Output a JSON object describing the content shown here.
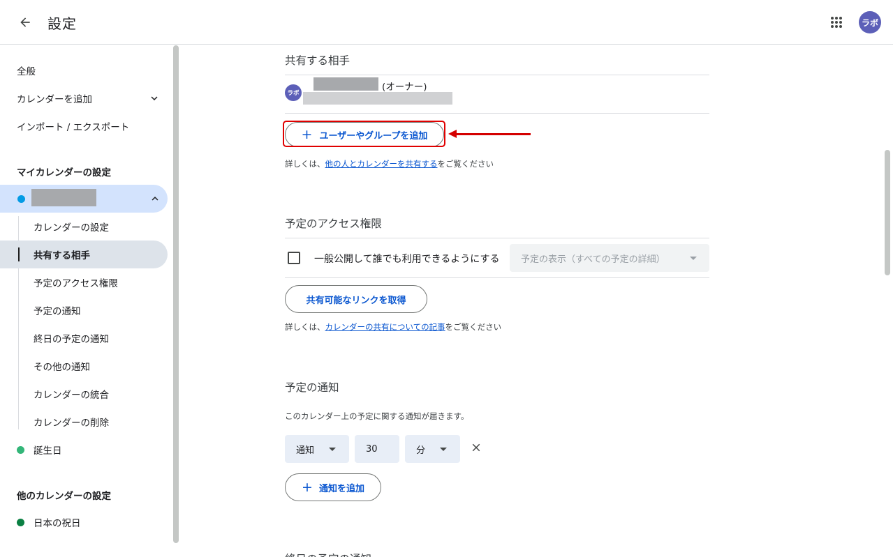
{
  "header": {
    "title": "設定",
    "avatar_text": "ラボ",
    "back_icon": "arrow-left-icon",
    "apps_icon": "apps-grid-icon"
  },
  "sidebar": {
    "general": "全般",
    "add_calendar": "カレンダーを追加",
    "import_export": "インポート / エクスポート",
    "my_calendars_heading": "マイカレンダーの設定",
    "sub_items": [
      "カレンダーの設定",
      "共有する相手",
      "予定のアクセス権限",
      "予定の通知",
      "終日の予定の通知",
      "その他の通知",
      "カレンダーの統合",
      "カレンダーの削除"
    ],
    "birthdays": "誕生日",
    "other_calendars_heading": "他のカレンダーの設定",
    "holidays": "日本の祝日"
  },
  "sharing": {
    "title": "共有する相手",
    "owner_avatar": "ラボ",
    "owner_suffix": "(オーナー)",
    "add_people_button": "ユーザーやグループを追加",
    "help_prefix": "詳しくは、",
    "help_link": "他の人とカレンダーを共有する",
    "help_suffix": "をご覧ください"
  },
  "access": {
    "title": "予定のアクセス権限",
    "public_label": "一般公開して誰でも利用できるようにする",
    "visibility_select": "予定の表示（すべての予定の詳細）",
    "link_button": "共有可能なリンクを取得",
    "help_prefix": "詳しくは、",
    "help_link": "カレンダーの共有についての記事",
    "help_suffix": "をご覧ください"
  },
  "notifications": {
    "title": "予定の通知",
    "description": "このカレンダー上の予定に関する通知が届きます。",
    "type": "通知",
    "amount": "30",
    "unit": "分",
    "add_button": "通知を追加"
  },
  "next_section_title": "終日の予定の通知",
  "colors": {
    "accent": "#0b57d0",
    "selected_bg": "#d3e3fd",
    "highlight_red": "#e00000",
    "calendar_dot_main": "#039be5",
    "calendar_dot_birthdays": "#33b679",
    "calendar_dot_holidays": "#0b8043"
  }
}
